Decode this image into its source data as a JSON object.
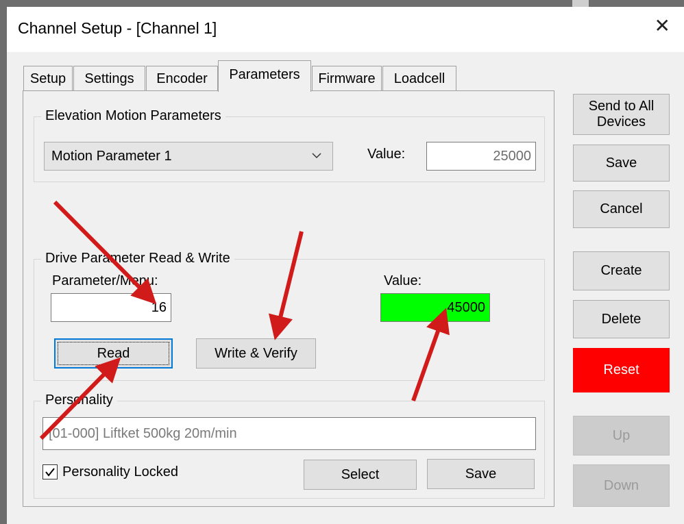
{
  "window": {
    "title": "Channel Setup - [Channel 1]"
  },
  "tabs": [
    {
      "label": "Setup",
      "active": false
    },
    {
      "label": "Settings",
      "active": false
    },
    {
      "label": "Encoder",
      "active": false
    },
    {
      "label": "Parameters",
      "active": true
    },
    {
      "label": "Firmware",
      "active": false
    },
    {
      "label": "Loadcell",
      "active": false
    }
  ],
  "elevation": {
    "group_label": "Elevation Motion Parameters",
    "selected_parameter": "Motion Parameter 1",
    "value_label": "Value:",
    "value": "25000"
  },
  "drive": {
    "group_label": "Drive Parameter Read & Write",
    "parameter_label": "Parameter/Menu:",
    "parameter_value": "16",
    "value_label": "Value:",
    "value": "45000",
    "read_label": "Read",
    "write_label": "Write & Verify"
  },
  "personality": {
    "group_label": "Personality",
    "name": "[01-000] Liftket 500kg 20m/min",
    "locked_label": "Personality Locked",
    "locked": true,
    "select_label": "Select",
    "save_label": "Save"
  },
  "side_buttons": {
    "send_all": "Send to All Devices",
    "save": "Save",
    "cancel": "Cancel",
    "create": "Create",
    "delete": "Delete",
    "reset": "Reset",
    "up": "Up",
    "down": "Down"
  },
  "colors": {
    "reset_bg": "#ff0000",
    "value_highlight": "#00ff00",
    "annotation_arrow": "#d11a1a"
  }
}
